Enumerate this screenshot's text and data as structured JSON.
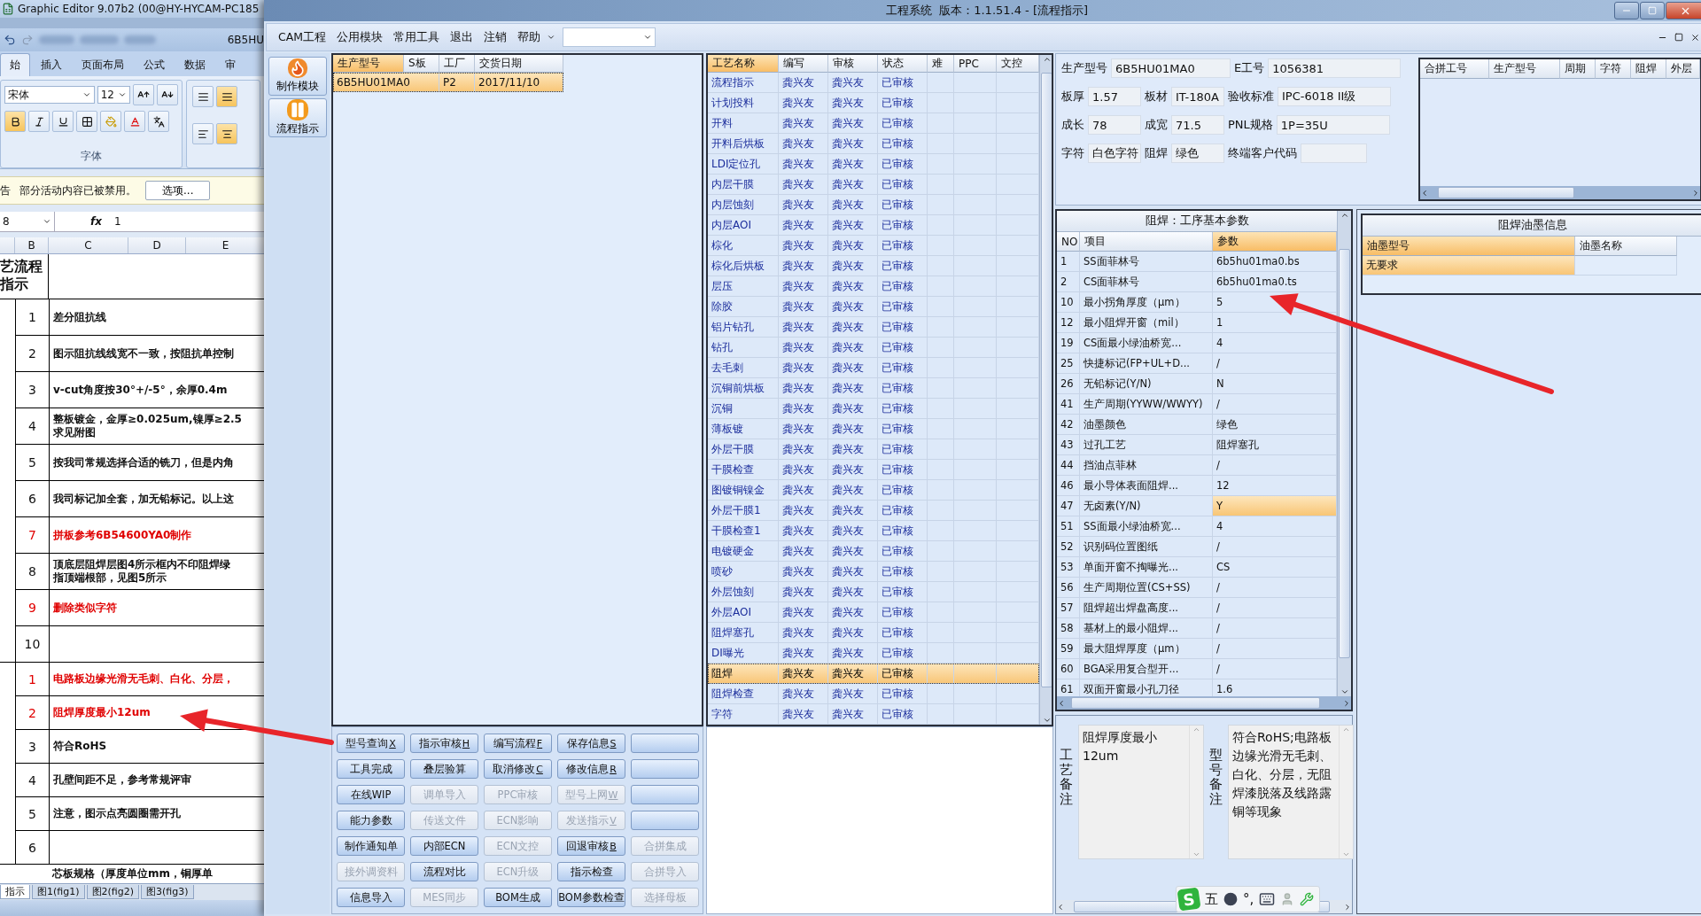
{
  "excel": {
    "title": "Graphic Editor 9.07b2 (00@HY-HYCAM-PC185",
    "quick_text": "6B5HU",
    "tabs": [
      {
        "label": "始",
        "selected": true
      },
      {
        "label": "插入",
        "selected": false
      },
      {
        "label": "页面布局",
        "selected": false
      },
      {
        "label": "公式",
        "selected": false
      },
      {
        "label": "数据",
        "selected": false
      },
      {
        "label": "审",
        "selected": false
      }
    ],
    "font_name": "宋体",
    "font_size": "12",
    "bold": true,
    "group_label": "字体",
    "warning_tail": "告",
    "warning": "部分活动内容已被禁用。",
    "options_button": "选项...",
    "name_box": "8",
    "fx": "fx",
    "formula": "1",
    "columns": [
      "B",
      "C",
      "D",
      "E"
    ],
    "header_cell": [
      "艺流程",
      "指示"
    ],
    "sections": [
      {
        "rows": [
          {
            "no": "1",
            "lines": [
              "差分阻抗线"
            ],
            "red": false
          },
          {
            "no": "2",
            "lines": [
              "图示阻抗线线宽不一致，按阻抗单控制"
            ],
            "red": false
          },
          {
            "no": "3",
            "lines": [
              "v-cut角度按30°+/-5°，余厚0.4m"
            ],
            "red": false
          },
          {
            "no": "4",
            "lines": [
              "整板镀金，金厚≥0.025um,镍厚≥2.5",
              "求见附图"
            ],
            "red": false
          },
          {
            "no": "5",
            "lines": [
              "按我司常规选择合适的铣刀，但是内角"
            ],
            "red": false
          },
          {
            "no": "6",
            "lines": [
              "我司标记加全套，加无铅标记。以上这"
            ],
            "red": false
          },
          {
            "no": "7",
            "lines": [
              "拼板参考6B54600YA0制作"
            ],
            "red": true
          },
          {
            "no": "8",
            "lines": [
              "顶底层阻焊层图4所示框内不印阻焊绿",
              "指顶端根部，见图5所示"
            ],
            "red": false
          },
          {
            "no": "9",
            "lines": [
              "删除类似字符"
            ],
            "red": true
          },
          {
            "no": "10",
            "red": false
          }
        ]
      },
      {
        "rows": [
          {
            "no": "1",
            "lines": [
              "电路板边缘光滑无毛刺、白化、分层，"
            ],
            "red": true
          },
          {
            "no": "2",
            "lines": [
              "阻焊厚度最小12um"
            ],
            "red": true
          },
          {
            "no": "3",
            "lines": [
              "符合RoHS"
            ],
            "red": false
          },
          {
            "no": "4",
            "lines": [
              "孔壁间距不足，参考常规评审"
            ],
            "red": false
          },
          {
            "no": "5",
            "lines": [
              "注意，图示点亮圆圈需开孔"
            ],
            "red": false
          },
          {
            "no": "6",
            "red": false
          }
        ]
      }
    ],
    "trailing_text": "芯板规格（厚度单位mm，铜厚单",
    "sheet_tabs": [
      {
        "label": "指示",
        "selected": true
      },
      {
        "label": "图1(fig1)",
        "selected": false
      },
      {
        "label": "图2(fig2)",
        "selected": false
      },
      {
        "label": "图3(fig3)",
        "selected": false
      }
    ]
  },
  "app": {
    "title": "工程系统  版本：1.1.51.4 - [流程指示]",
    "menu": [
      "CAM工程",
      "公用模块",
      "常用工具",
      "退出",
      "注销",
      "帮助"
    ],
    "side_tools": [
      {
        "kind": "make",
        "label": "制作模块"
      },
      {
        "kind": "flow",
        "label": "流程指示"
      }
    ],
    "orders": {
      "columns": [
        {
          "label": "生产型号",
          "sorted": true
        },
        {
          "label": "S板",
          "sorted": false
        },
        {
          "label": "工厂",
          "sorted": false
        },
        {
          "label": "交货日期",
          "sorted": false
        }
      ],
      "rows": [
        {
          "model": "6B5HU01MA0",
          "factory": "P2",
          "date": "2017/11/10",
          "selected": true
        }
      ]
    },
    "processes": {
      "columns": [
        {
          "label": "工艺名称",
          "sorted": true
        },
        {
          "label": "编写",
          "sorted": false
        },
        {
          "label": "审核",
          "sorted": false
        },
        {
          "label": "状态",
          "sorted": false
        },
        {
          "label": "难",
          "sorted": false
        },
        {
          "label": "PPC",
          "sorted": false
        },
        {
          "label": "文控",
          "sorted": false
        }
      ],
      "rows": [
        {
          "name": "流程指示",
          "writer": "龚兴友",
          "reviewer": "龚兴友",
          "status": "已审核",
          "selected": false
        },
        {
          "name": "计划投料",
          "writer": "龚兴友",
          "reviewer": "龚兴友",
          "status": "已审核",
          "selected": false
        },
        {
          "name": "开料",
          "writer": "龚兴友",
          "reviewer": "龚兴友",
          "status": "已审核",
          "selected": false
        },
        {
          "name": "开料后烘板",
          "writer": "龚兴友",
          "reviewer": "龚兴友",
          "status": "已审核",
          "selected": false
        },
        {
          "name": "LDI定位孔",
          "writer": "龚兴友",
          "reviewer": "龚兴友",
          "status": "已审核",
          "selected": false
        },
        {
          "name": "内层干膜",
          "writer": "龚兴友",
          "reviewer": "龚兴友",
          "status": "已审核",
          "selected": false
        },
        {
          "name": "内层蚀刻",
          "writer": "龚兴友",
          "reviewer": "龚兴友",
          "status": "已审核",
          "selected": false
        },
        {
          "name": "内层AOI",
          "writer": "龚兴友",
          "reviewer": "龚兴友",
          "status": "已审核",
          "selected": false
        },
        {
          "name": "棕化",
          "writer": "龚兴友",
          "reviewer": "龚兴友",
          "status": "已审核",
          "selected": false
        },
        {
          "name": "棕化后烘板",
          "writer": "龚兴友",
          "reviewer": "龚兴友",
          "status": "已审核",
          "selected": false
        },
        {
          "name": "层压",
          "writer": "龚兴友",
          "reviewer": "龚兴友",
          "status": "已审核",
          "selected": false
        },
        {
          "name": "除胶",
          "writer": "龚兴友",
          "reviewer": "龚兴友",
          "status": "已审核",
          "selected": false
        },
        {
          "name": "铝片钻孔",
          "writer": "龚兴友",
          "reviewer": "龚兴友",
          "status": "已审核",
          "selected": false
        },
        {
          "name": "钻孔",
          "writer": "龚兴友",
          "reviewer": "龚兴友",
          "status": "已审核",
          "selected": false
        },
        {
          "name": "去毛刺",
          "writer": "龚兴友",
          "reviewer": "龚兴友",
          "status": "已审核",
          "selected": false
        },
        {
          "name": "沉铜前烘板",
          "writer": "龚兴友",
          "reviewer": "龚兴友",
          "status": "已审核",
          "selected": false
        },
        {
          "name": "沉铜",
          "writer": "龚兴友",
          "reviewer": "龚兴友",
          "status": "已审核",
          "selected": false
        },
        {
          "name": "薄板镀",
          "writer": "龚兴友",
          "reviewer": "龚兴友",
          "status": "已审核",
          "selected": false
        },
        {
          "name": "外层干膜",
          "writer": "龚兴友",
          "reviewer": "龚兴友",
          "status": "已审核",
          "selected": false
        },
        {
          "name": "干膜检查",
          "writer": "龚兴友",
          "reviewer": "龚兴友",
          "status": "已审核",
          "selected": false
        },
        {
          "name": "图镀铜镍金",
          "writer": "龚兴友",
          "reviewer": "龚兴友",
          "status": "已审核",
          "selected": false
        },
        {
          "name": "外层干膜1",
          "writer": "龚兴友",
          "reviewer": "龚兴友",
          "status": "已审核",
          "selected": false
        },
        {
          "name": "干膜检查1",
          "writer": "龚兴友",
          "reviewer": "龚兴友",
          "status": "已审核",
          "selected": false
        },
        {
          "name": "电镀硬金",
          "writer": "龚兴友",
          "reviewer": "龚兴友",
          "status": "已审核",
          "selected": false
        },
        {
          "name": "喷砂",
          "writer": "龚兴友",
          "reviewer": "龚兴友",
          "status": "已审核",
          "selected": false
        },
        {
          "name": "外层蚀刻",
          "writer": "龚兴友",
          "reviewer": "龚兴友",
          "status": "已审核",
          "selected": false
        },
        {
          "name": "外层AOI",
          "writer": "龚兴友",
          "reviewer": "龚兴友",
          "status": "已审核",
          "selected": false
        },
        {
          "name": "阻焊塞孔",
          "writer": "龚兴友",
          "reviewer": "龚兴友",
          "status": "已审核",
          "selected": false
        },
        {
          "name": "DI曝光",
          "writer": "龚兴友",
          "reviewer": "龚兴友",
          "status": "已审核",
          "selected": false
        },
        {
          "name": "阻焊",
          "writer": "龚兴友",
          "reviewer": "龚兴友",
          "status": "已审核",
          "selected": true
        },
        {
          "name": "阻焊检查",
          "writer": "龚兴友",
          "reviewer": "龚兴友",
          "status": "已审核",
          "selected": false
        },
        {
          "name": "字符",
          "writer": "龚兴友",
          "reviewer": "龚兴友",
          "status": "已审核",
          "selected": false
        }
      ]
    },
    "buttons": [
      {
        "kind": "action",
        "label": "型号查询",
        "key": "X",
        "disabled": false
      },
      {
        "kind": "action",
        "label": "指示审核",
        "key": "H",
        "disabled": false
      },
      {
        "kind": "action",
        "label": "编写流程",
        "key": "F",
        "disabled": false
      },
      {
        "kind": "action",
        "label": "保存信息",
        "key": "S",
        "disabled": false
      },
      {
        "kind": "blank",
        "disabled": false
      },
      {
        "kind": "action",
        "label": "工具完成",
        "disabled": false
      },
      {
        "kind": "action",
        "label": "叠层验算",
        "disabled": false
      },
      {
        "kind": "action",
        "label": "取消修改",
        "key": "C",
        "disabled": false
      },
      {
        "kind": "action",
        "label": "修改信息",
        "key": "R",
        "disabled": false
      },
      {
        "kind": "blank",
        "disabled": false
      },
      {
        "kind": "action",
        "label": "在线WIP",
        "disabled": false
      },
      {
        "kind": "action",
        "label": "调单导入",
        "disabled": true
      },
      {
        "kind": "action",
        "label": "PPC审核",
        "disabled": true
      },
      {
        "kind": "action",
        "label": "型号上网",
        "key": "W",
        "disabled": true
      },
      {
        "kind": "blank",
        "disabled": false
      },
      {
        "kind": "action",
        "label": "能力参数",
        "disabled": false
      },
      {
        "kind": "action",
        "label": "传送文件",
        "disabled": true
      },
      {
        "kind": "action",
        "label": "ECN影响",
        "disabled": true
      },
      {
        "kind": "action",
        "label": "发送指示",
        "key": "V",
        "disabled": true
      },
      {
        "kind": "blank",
        "disabled": false
      },
      {
        "kind": "action",
        "label": "制作通知单",
        "disabled": false
      },
      {
        "kind": "action",
        "label": "内部ECN",
        "disabled": false
      },
      {
        "kind": "action",
        "label": "ECN文控",
        "disabled": true
      },
      {
        "kind": "action",
        "label": "回退审核",
        "key": "B",
        "disabled": false
      },
      {
        "kind": "action",
        "label": "合拼集成",
        "disabled": true
      },
      {
        "kind": "action",
        "label": "接外调资料",
        "disabled": true
      },
      {
        "kind": "action",
        "label": "流程对比",
        "disabled": false
      },
      {
        "kind": "action",
        "label": "ECN升级",
        "disabled": true
      },
      {
        "kind": "action",
        "label": "指示检查",
        "disabled": false
      },
      {
        "kind": "action",
        "label": "合拼导入",
        "disabled": true
      },
      {
        "kind": "action",
        "label": "信息导入",
        "disabled": false
      },
      {
        "kind": "action",
        "label": "MES同步",
        "disabled": true
      },
      {
        "kind": "action",
        "label": "BOM生成",
        "disabled": false
      },
      {
        "kind": "action",
        "label": "BOM参数检查",
        "disabled": false
      },
      {
        "kind": "action",
        "label": "选择母板",
        "disabled": true
      }
    ],
    "info": [
      [
        {
          "label": "生产型号",
          "value": "6B5HU01MA0"
        },
        {
          "label": "E工号",
          "value": "1056381"
        }
      ],
      [
        {
          "label": "板厚",
          "value": "1.57"
        },
        {
          "label": "板材",
          "value": "IT-180A"
        },
        {
          "label": "验收标准",
          "value": "IPC-6018 II级"
        }
      ],
      [
        {
          "label": "成长",
          "value": "78"
        },
        {
          "label": "成宽",
          "value": "71.5"
        },
        {
          "label": "PNL规格",
          "value": "1P=35U"
        }
      ],
      [
        {
          "label": "字符",
          "value": "白色字符"
        },
        {
          "label": "阻焊",
          "value": "绿色"
        },
        {
          "label": "终端客户代码"
        }
      ]
    ],
    "merge_table": {
      "columns": [
        "合拼工号",
        "生产型号",
        "周期",
        "字符",
        "阻焊",
        "外层"
      ]
    },
    "params": {
      "title": "阻焊：工序基本参数",
      "columns": [
        {
          "label": "NO",
          "sorted": false
        },
        {
          "label": "项目",
          "sorted": false
        },
        {
          "label": "参数",
          "sorted": true
        }
      ],
      "rows": [
        {
          "no": "1",
          "item": "SS面菲林号",
          "value": "6b5hu01ma0.bs",
          "selected": false
        },
        {
          "no": "2",
          "item": "CS面菲林号",
          "value": "6b5hu01ma0.ts",
          "selected": false
        },
        {
          "no": "10",
          "item": "最小拐角厚度（μm）",
          "value": "5",
          "selected": false
        },
        {
          "no": "12",
          "item": "最小阻焊开窗（mil）",
          "value": "1",
          "selected": false
        },
        {
          "no": "19",
          "item": "CS面最小绿油桥宽...",
          "value": "4",
          "selected": false
        },
        {
          "no": "25",
          "item": "快捷标记(FP+UL+D...",
          "value": "/",
          "selected": false
        },
        {
          "no": "26",
          "item": "无铅标记(Y/N)",
          "value": "N",
          "selected": false
        },
        {
          "no": "41",
          "item": "生产周期(YYWW/WWYY)",
          "value": "/",
          "selected": false
        },
        {
          "no": "42",
          "item": "油墨颜色",
          "value": "绿色",
          "selected": false
        },
        {
          "no": "43",
          "item": "过孔工艺",
          "value": "阻焊塞孔",
          "selected": false
        },
        {
          "no": "44",
          "item": "挡油点菲林",
          "value": "/",
          "selected": false
        },
        {
          "no": "46",
          "item": "最小导体表面阻焊...",
          "value": "12",
          "selected": false
        },
        {
          "no": "47",
          "item": "无卤素(Y/N)",
          "value": "Y",
          "selected": true
        },
        {
          "no": "51",
          "item": "SS面最小绿油桥宽...",
          "value": "4",
          "selected": false
        },
        {
          "no": "52",
          "item": "识别码位置图纸",
          "value": "/",
          "selected": false
        },
        {
          "no": "53",
          "item": "单面开窗不掏曝光...",
          "value": "CS",
          "selected": false
        },
        {
          "no": "56",
          "item": "生产周期位置(CS+SS)",
          "value": "/",
          "selected": false
        },
        {
          "no": "57",
          "item": "阻焊超出焊盘高度...",
          "value": "/",
          "selected": false
        },
        {
          "no": "58",
          "item": "基材上的最小阻焊...",
          "value": "/",
          "selected": false
        },
        {
          "no": "59",
          "item": "最大阻焊厚度（μm）",
          "value": "/",
          "selected": false
        },
        {
          "no": "60",
          "item": "BGA采用复合型开...",
          "value": "/",
          "selected": false
        },
        {
          "no": "61",
          "item": "双面开窗最小孔刀径",
          "value": "1.6",
          "selected": false
        }
      ]
    },
    "ink": {
      "title": "阻焊油墨信息",
      "columns": [
        {
          "label": "油墨型号",
          "sorted": true
        },
        {
          "label": "油墨名称",
          "sorted": false
        }
      ],
      "rows": [
        {
          "model": "无要求",
          "selected": true
        }
      ]
    },
    "remarks": [
      {
        "label": "工艺备注",
        "text": "阻焊厚度最小12um"
      },
      {
        "label": "型号备注",
        "text": "符合RoHS;电路板边缘光滑无毛刺、白化、分层，无阻焊漆脱落及线路露铜等现象"
      }
    ],
    "ime": {
      "logo": "S",
      "mode": "五",
      "punct": "°,"
    }
  }
}
